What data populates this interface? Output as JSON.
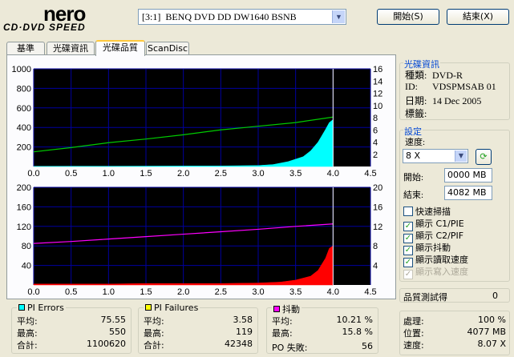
{
  "app": {
    "logo_text": "nero",
    "logo_sub": "CD·DVD SPEED",
    "drive": "[3:1]  BENQ DVD DD DW1640 BSNB",
    "start_button": "開始(S)",
    "exit_button": "結束(X)"
  },
  "tabs": [
    {
      "label": "基準"
    },
    {
      "label": "光碟資訊"
    },
    {
      "label": "光碟品質"
    },
    {
      "label": "ScanDisc"
    }
  ],
  "disc_info": {
    "title": "光碟資訊",
    "type_label": "種類:",
    "type_value": "DVD-R",
    "id_label": "ID:",
    "id_value": "VDSPMSAB 01",
    "date_label": "日期:",
    "date_value": "14 Dec 2005",
    "tag_label": "標籤:",
    "tag_value": ""
  },
  "settings": {
    "title": "設定",
    "speed_label": "速度:",
    "speed_value": "8 X",
    "start_label": "開始:",
    "start_value": "0000 MB",
    "end_label": "結束:",
    "end_value": "4082 MB",
    "options": [
      {
        "label": "快速掃描",
        "checked": false,
        "disabled": false
      },
      {
        "label": "顯示 C1/PIE",
        "checked": true,
        "disabled": false
      },
      {
        "label": "顯示 C2/PIF",
        "checked": true,
        "disabled": false
      },
      {
        "label": "顯示抖動",
        "checked": true,
        "disabled": false
      },
      {
        "label": "顯示讀取速度",
        "checked": true,
        "disabled": false
      },
      {
        "label": "顯示寫入速度",
        "checked": true,
        "disabled": true
      }
    ]
  },
  "quality": {
    "label": "品質測試得",
    "value": "0"
  },
  "progress": {
    "process_label": "處理:",
    "process_value": "100 %",
    "position_label": "位置:",
    "position_value": "4077 MB",
    "speed_label": "速度:",
    "speed_value": "8.07 X"
  },
  "pi_errors": {
    "title": "PI Errors",
    "color": "#00ffff",
    "avg_label": "平均:",
    "avg": "75.55",
    "max_label": "最高:",
    "max": "550",
    "total_label": "合計:",
    "total": "1100620"
  },
  "pi_failures": {
    "title": "PI Failures",
    "color": "#ffff00",
    "avg_label": "平均:",
    "avg": "3.58",
    "max_label": "最高:",
    "max": "119",
    "total_label": "合計:",
    "total": "42348"
  },
  "jitter": {
    "title": "抖動",
    "color": "#ff00ff",
    "avg_label": "平均:",
    "avg": "10.21 %",
    "max_label": "最高:",
    "max": "15.8 %",
    "po_label": "PO 失敗:",
    "po": "56"
  },
  "chart_data": [
    {
      "type": "area",
      "title": "",
      "xlabel": "",
      "ylabel": "",
      "x_ticks": [
        "0.0",
        "0.5",
        "1.0",
        "1.5",
        "2.0",
        "2.5",
        "3.0",
        "3.5",
        "4.0",
        "4.5"
      ],
      "xlim": [
        0,
        4.5
      ],
      "ylim": [
        0,
        1000
      ],
      "y_ticks": [
        "200",
        "400",
        "600",
        "800",
        "1000"
      ],
      "y2lim": [
        0,
        16
      ],
      "y2_ticks": [
        "2",
        "4",
        "6",
        "8",
        "10",
        "12",
        "14",
        "16"
      ],
      "grid": true,
      "series": [
        {
          "color": "#00ffff",
          "x": [
            0,
            0.5,
            1.0,
            1.5,
            2.0,
            2.5,
            3.0,
            3.2,
            3.4,
            3.6,
            3.7,
            3.8,
            3.9,
            3.95,
            4.0
          ],
          "values": [
            2,
            3,
            3,
            4,
            5,
            6,
            10,
            20,
            50,
            100,
            160,
            250,
            380,
            450,
            480
          ]
        },
        {
          "color": "#00cc00",
          "axis": "y2",
          "x": [
            0,
            0.5,
            1.0,
            1.5,
            2.0,
            2.5,
            3.0,
            3.5,
            4.0
          ],
          "values": [
            2.4,
            3.1,
            3.9,
            4.5,
            5.2,
            6.0,
            6.6,
            7.2,
            8.1
          ]
        }
      ]
    },
    {
      "type": "area",
      "title": "",
      "xlabel": "",
      "ylabel": "",
      "x_ticks": [
        "0.0",
        "0.5",
        "1.0",
        "1.5",
        "2.0",
        "2.5",
        "3.0",
        "3.5",
        "4.0",
        "4.5"
      ],
      "xlim": [
        0,
        4.5
      ],
      "ylim": [
        0,
        200
      ],
      "y_ticks": [
        "40",
        "80",
        "120",
        "160",
        "200"
      ],
      "y2lim": [
        0,
        20
      ],
      "y2_ticks": [
        "4",
        "8",
        "12",
        "16",
        "20"
      ],
      "grid": true,
      "series": [
        {
          "color": "#ff0000",
          "x": [
            0,
            0.5,
            1.0,
            1.5,
            2.0,
            2.5,
            3.0,
            3.3,
            3.5,
            3.7,
            3.8,
            3.9,
            3.95,
            4.0
          ],
          "values": [
            2,
            2,
            2,
            3,
            3,
            3,
            4,
            6,
            10,
            18,
            30,
            55,
            75,
            80
          ]
        },
        {
          "color": "#ff00ff",
          "axis": "y2",
          "x": [
            0,
            0.5,
            1.0,
            1.5,
            2.0,
            2.5,
            3.0,
            3.5,
            4.0
          ],
          "values": [
            8.5,
            8.9,
            9.4,
            9.9,
            10.4,
            10.9,
            11.4,
            12.0,
            12.5
          ]
        }
      ]
    }
  ]
}
